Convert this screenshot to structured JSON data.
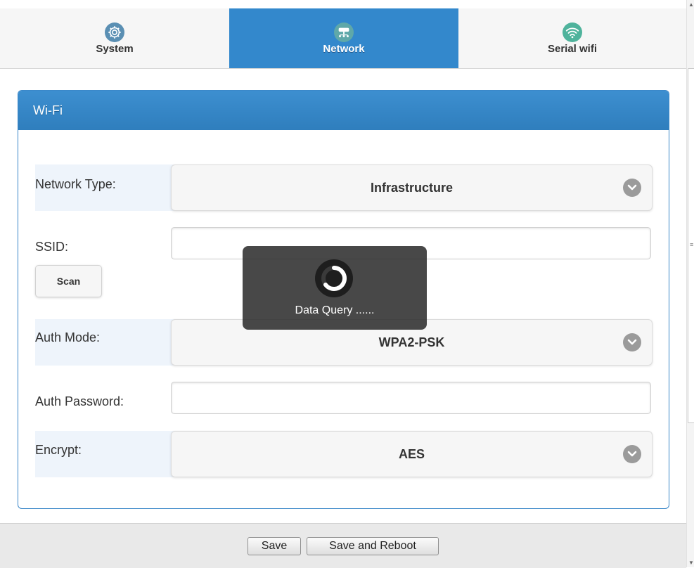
{
  "tabs": [
    {
      "label": "System",
      "icon": "gear-icon",
      "active": false
    },
    {
      "label": "Network",
      "icon": "network-icon",
      "active": true
    },
    {
      "label": "Serial wifi",
      "icon": "wifi-icon",
      "active": false
    }
  ],
  "panel": {
    "title": "Wi-Fi",
    "fields": {
      "network_type": {
        "label": "Network Type:",
        "value": "Infrastructure"
      },
      "ssid": {
        "label": "SSID:",
        "value": "",
        "placeholder": ""
      },
      "scan": {
        "label": "Scan"
      },
      "auth_mode": {
        "label": "Auth Mode:",
        "value": "WPA2-PSK"
      },
      "auth_password": {
        "label": "Auth Password:",
        "value": "",
        "placeholder": ""
      },
      "encrypt": {
        "label": "Encrypt:",
        "value": "AES"
      }
    }
  },
  "footer": {
    "save_label": "Save",
    "save_reboot_label": "Save and Reboot"
  },
  "loader": {
    "text": "Data Query ......"
  },
  "colors": {
    "accent": "#3388cc",
    "tab_bg": "#f6f6f6",
    "label_bg": "#eef4fb",
    "loader_bg": "#282828"
  }
}
